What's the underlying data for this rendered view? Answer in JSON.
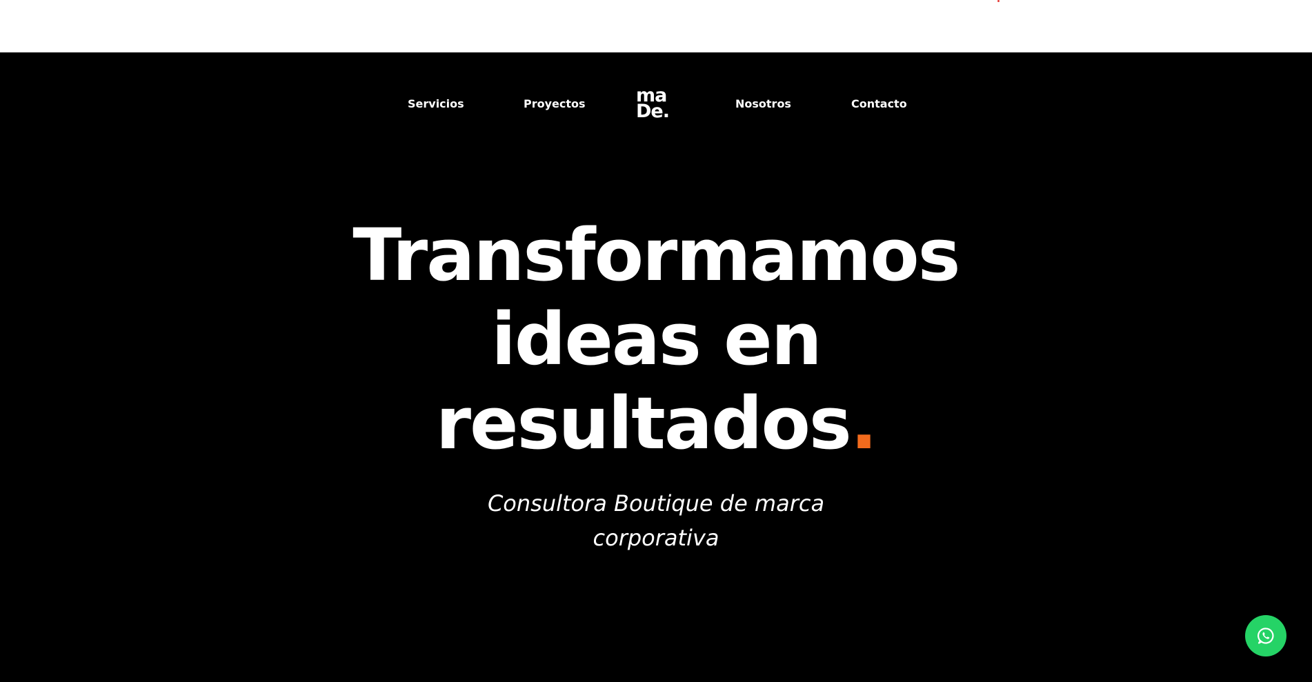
{
  "nav": {
    "items": [
      {
        "label": "Servicios"
      },
      {
        "label": "Proyectos"
      },
      {
        "label": "Nosotros"
      },
      {
        "label": "Contacto"
      }
    ],
    "logo": {
      "line1": "ma",
      "line2": "De."
    }
  },
  "hero": {
    "headline_lines": [
      "Transformamos",
      "ideas en",
      "resultados"
    ],
    "headline_accent": ".",
    "subtitle_lines": [
      "Consultora Boutique de marca",
      "corporativa"
    ]
  },
  "colors": {
    "background": "#000000",
    "text": "#ffffff",
    "accent": "#f26b1d",
    "whatsapp": "#25d366"
  },
  "icons": {
    "whatsapp_button": "whatsapp-icon"
  }
}
